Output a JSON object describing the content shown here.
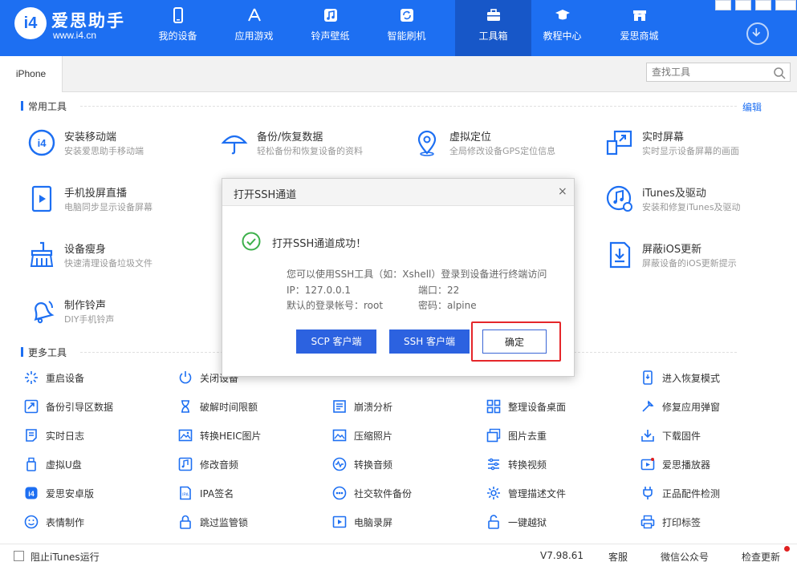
{
  "header": {
    "brand": "爱思助手",
    "domain": "www.i4.cn",
    "logo_text": "i4",
    "nav": [
      {
        "label": "我的设备",
        "icon": "phone-icon"
      },
      {
        "label": "应用游戏",
        "icon": "app-store-icon"
      },
      {
        "label": "铃声壁纸",
        "icon": "music-note-icon"
      },
      {
        "label": "智能刷机",
        "icon": "refresh-icon"
      },
      {
        "label": "工具箱",
        "icon": "toolbox-icon",
        "active": true
      },
      {
        "label": "教程中心",
        "icon": "graduation-cap-icon"
      },
      {
        "label": "爱思商城",
        "icon": "shop-icon"
      }
    ],
    "accent": "#1d6ff2"
  },
  "tabs": {
    "device_tab": "iPhone"
  },
  "search": {
    "placeholder": "查找工具"
  },
  "common_tools": {
    "title": "常用工具",
    "edit_label": "编辑",
    "items": [
      {
        "name": "安装移动端",
        "desc": "安装爱思助手移动端",
        "icon": "i4-install-icon"
      },
      {
        "name": "备份/恢复数据",
        "desc": "轻松备份和恢复设备的资料",
        "icon": "umbrella-icon"
      },
      {
        "name": "虚拟定位",
        "desc": "全局修改设备GPS定位信息",
        "icon": "location-pin-icon"
      },
      {
        "name": "实时屏幕",
        "desc": "实时显示设备屏幕的画面",
        "icon": "screen-mirror-icon"
      },
      {
        "name": "手机投屏直播",
        "desc": "电脑同步显示设备屏幕",
        "icon": "phone-cast-icon"
      },
      {
        "name": "iTunes及驱动",
        "desc": "安装和修复iTunes及驱动",
        "icon": "itunes-icon"
      },
      {
        "name": "设备瘦身",
        "desc": "快速清理设备垃圾文件",
        "icon": "broom-icon"
      },
      {
        "name": "屏蔽iOS更新",
        "desc": "屏蔽设备的iOS更新提示",
        "icon": "block-update-icon"
      },
      {
        "name": "制作铃声",
        "desc": "DIY手机铃声",
        "icon": "bell-icon"
      }
    ]
  },
  "more_tools": {
    "title": "更多工具",
    "items": [
      {
        "label": "重启设备",
        "icon": "restart-icon"
      },
      {
        "label": "关闭设备",
        "icon": "power-icon"
      },
      {
        "label": "进入恢复模式",
        "icon": "recovery-mode-icon"
      },
      {
        "label": "备份引导区数据",
        "icon": "backup-boot-icon"
      },
      {
        "label": "破解时间限额",
        "icon": "hourglass-icon"
      },
      {
        "label": "崩溃分析",
        "icon": "crash-analysis-icon"
      },
      {
        "label": "整理设备桌面",
        "icon": "desktop-grid-icon"
      },
      {
        "label": "修复应用弹窗",
        "icon": "repair-popup-icon"
      },
      {
        "label": "实时日志",
        "icon": "log-icon"
      },
      {
        "label": "转换HEIC图片",
        "icon": "heic-convert-icon"
      },
      {
        "label": "压缩照片",
        "icon": "compress-photo-icon"
      },
      {
        "label": "图片去重",
        "icon": "dedupe-photo-icon"
      },
      {
        "label": "下载固件",
        "icon": "firmware-download-icon"
      },
      {
        "label": "虚拟U盘",
        "icon": "usb-drive-icon"
      },
      {
        "label": "修改音频",
        "icon": "edit-audio-icon"
      },
      {
        "label": "转换音频",
        "icon": "convert-audio-icon"
      },
      {
        "label": "转换视频",
        "icon": "convert-video-icon"
      },
      {
        "label": "爱思播放器",
        "icon": "player-icon"
      },
      {
        "label": "爱思安卓版",
        "icon": "android-app-icon"
      },
      {
        "label": "IPA签名",
        "icon": "ipa-sign-icon"
      },
      {
        "label": "社交软件备份",
        "icon": "social-backup-icon"
      },
      {
        "label": "管理描述文件",
        "icon": "profile-manage-icon"
      },
      {
        "label": "正品配件检测",
        "icon": "accessory-check-icon"
      },
      {
        "label": "表情制作",
        "icon": "emoji-icon"
      },
      {
        "label": "跳过监管锁",
        "icon": "lock-skip-icon"
      },
      {
        "label": "电脑录屏",
        "icon": "screen-record-icon"
      },
      {
        "label": "一键越狱",
        "icon": "jailbreak-icon"
      },
      {
        "label": "打印标签",
        "icon": "print-label-icon"
      }
    ]
  },
  "dialog": {
    "title": "打开SSH通道",
    "close": "×",
    "success_message": "打开SSH通道成功！",
    "info_line": "您可以使用SSH工具（如：Xshell）登录到设备进行终端访问",
    "ip_label": "IP：127.0.0.1",
    "port_label": "端口：22",
    "account_label": "默认的登录帐号：root",
    "password_label": "密码：alpine",
    "scp_button": "SCP 客户端",
    "ssh_button": "SSH 客户端",
    "ok_button": "确定"
  },
  "footer": {
    "block_itunes": "阻止iTunes运行",
    "version": "V7.98.61",
    "support": "客服",
    "wechat": "微信公众号",
    "check_update": "检查更新"
  }
}
